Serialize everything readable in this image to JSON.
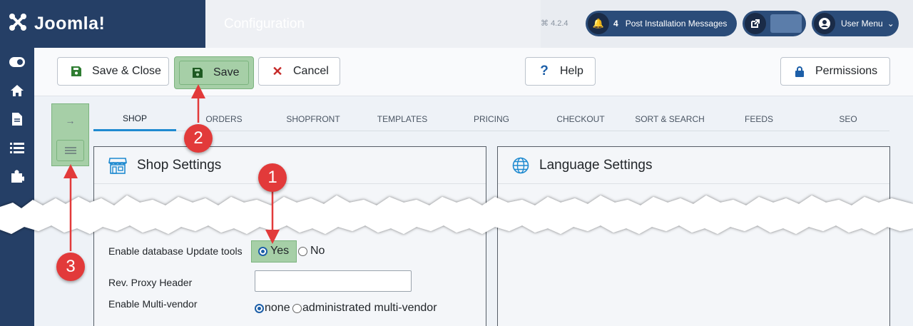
{
  "header": {
    "logo_text": "Joomla!",
    "page_title": "Configuration",
    "version": "4.2.4",
    "notifications_count": "4",
    "post_install_label": "Post Installation Messages",
    "user_menu_label": "User Menu"
  },
  "toolbar": {
    "save_close_label": "Save & Close",
    "save_label": "Save",
    "cancel_label": "Cancel",
    "help_label": "Help",
    "permissions_label": "Permissions"
  },
  "tabs": [
    "SHOP",
    "ORDERS",
    "SHOPFRONT",
    "TEMPLATES",
    "PRICING",
    "CHECKOUT",
    "SORT & SEARCH",
    "FEEDS",
    "SEO"
  ],
  "cards": {
    "shop_title": "Shop Settings",
    "language_title": "Language Settings"
  },
  "form": {
    "db_update_label": "Enable database Update tools",
    "db_update_yes": "Yes",
    "db_update_no": "No",
    "proxy_label": "Rev. Proxy Header",
    "proxy_value": "",
    "multivendor_label": "Enable Multi-vendor",
    "multivendor_none": "none",
    "multivendor_admin": "administrated multi-vendor"
  },
  "callouts": [
    "1",
    "2",
    "3"
  ],
  "colors": {
    "brand": "#253f66",
    "highlight": "#a6cfa7",
    "callout": "#e23a3a",
    "pill": "#2b4c79"
  }
}
